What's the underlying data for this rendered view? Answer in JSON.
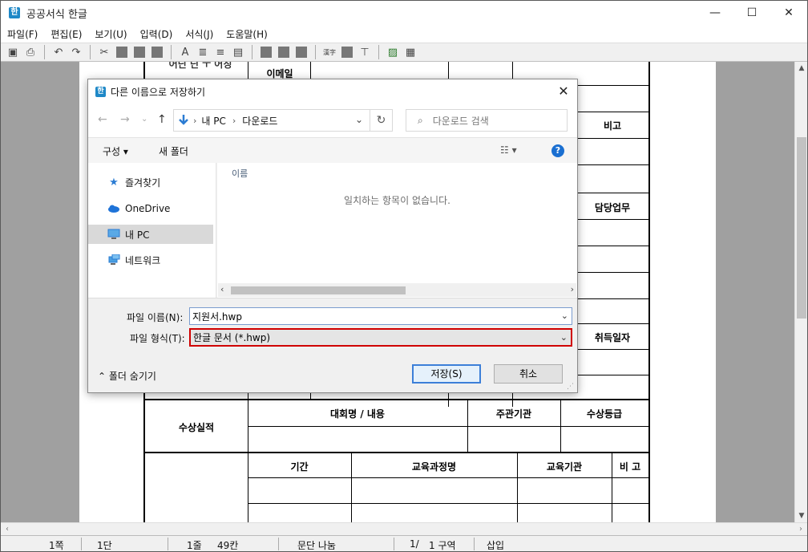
{
  "app": {
    "title": "공공서식 한글",
    "icon_glyph": "한",
    "window_buttons": {
      "minimize": "—",
      "maximize": "☐",
      "close": "✕"
    }
  },
  "menu": [
    "파일(F)",
    "편집(E)",
    "보기(U)",
    "입력(D)",
    "서식(J)",
    "도움말(H)"
  ],
  "document": {
    "cells": {
      "email": "이메일",
      "note": "비고",
      "duty": "담당업무",
      "acq_date": "취득일자",
      "award_header": "수상실적",
      "contest": "대회명 / 내용",
      "organizer": "주관기관",
      "grade": "수상등급",
      "period": "기간",
      "course": "교육과정명",
      "institution": "교육기관",
      "note2": "비 고",
      "top_partial": "어닌 닌 ㅜ 어칭"
    }
  },
  "dialog": {
    "title": "다른 이름으로 저장하기",
    "icon_glyph": "한",
    "breadcrumb": [
      "내 PC",
      "다운로드"
    ],
    "search_placeholder": "다운로드 검색",
    "organize_label": "구성 ▾",
    "new_folder_label": "새 폴더",
    "nav_items": [
      {
        "label": "즐겨찾기",
        "icon": "star-icon"
      },
      {
        "label": "OneDrive",
        "icon": "cloud-icon"
      },
      {
        "label": "내 PC",
        "icon": "computer-icon",
        "selected": true
      },
      {
        "label": "네트워크",
        "icon": "network-icon"
      }
    ],
    "column_header": "이름",
    "empty_message": "일치하는 항목이 없습니다.",
    "file_name_label": "파일 이름(N):",
    "file_name_value": "지원서.hwp",
    "file_type_label": "파일 형식(T):",
    "file_type_value": "한글 문서 (*.hwp)",
    "hide_folders_label": "폴더 숨기기",
    "save_label": "저장(S)",
    "cancel_label": "취소"
  },
  "status": {
    "page": "1쪽",
    "section_col": "1단",
    "line": "1줄",
    "column": "49칸",
    "para": "문단 나눔",
    "sections": "1/",
    "section": "1 구역",
    "mode": "삽입"
  }
}
